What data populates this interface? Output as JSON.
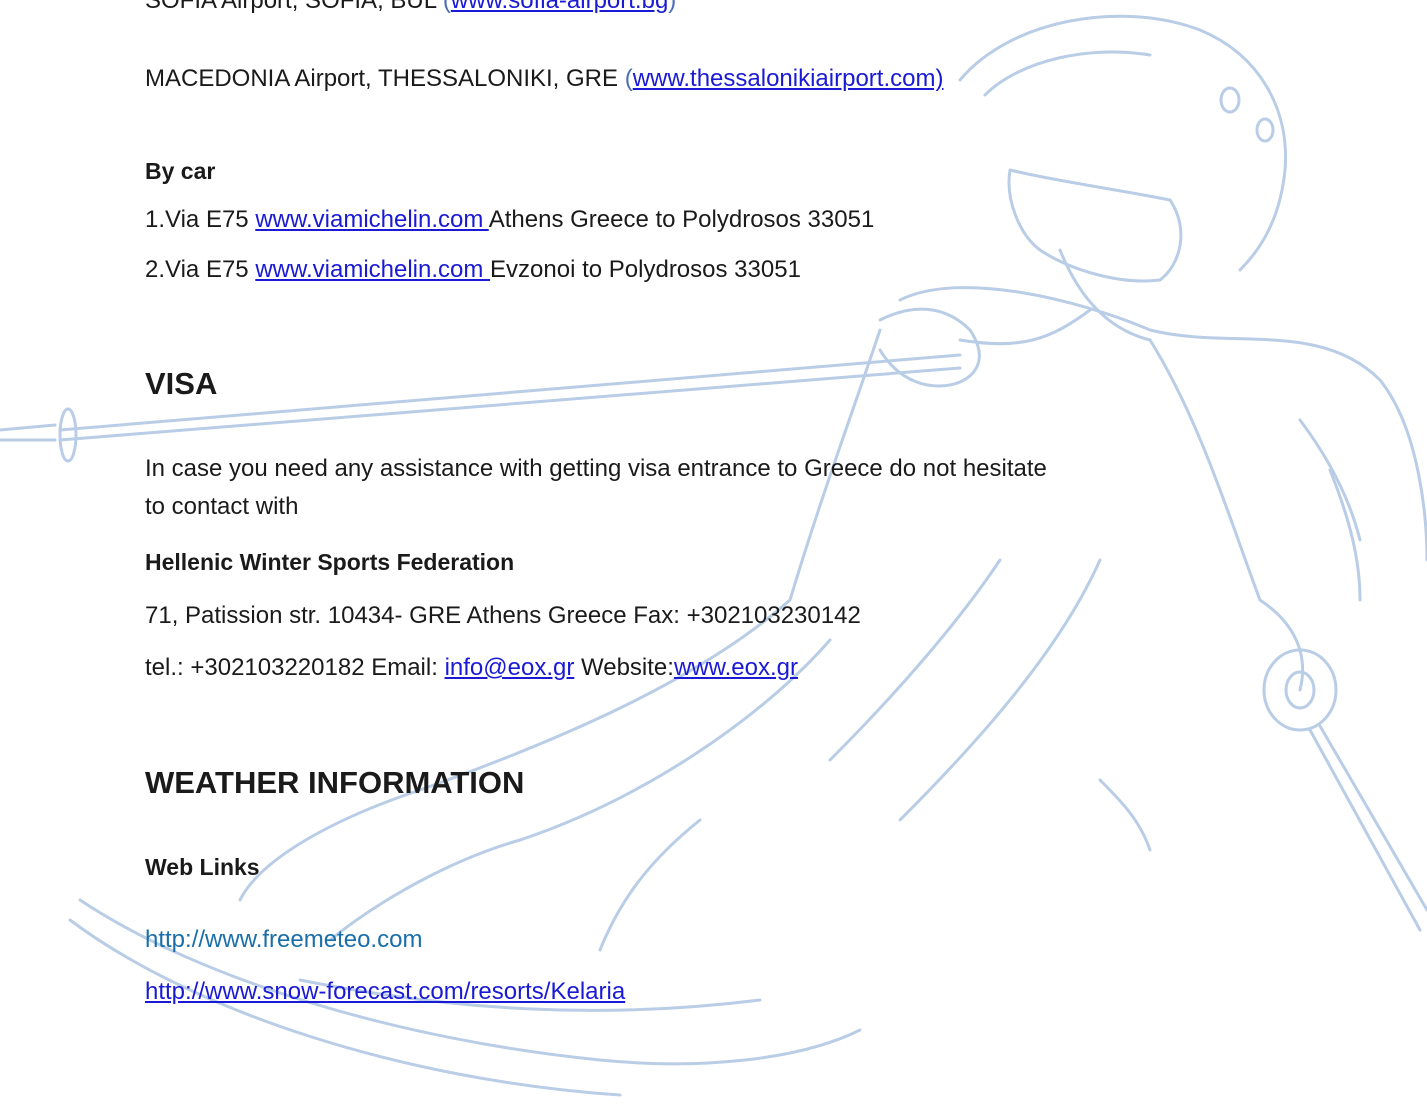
{
  "airport_cut": {
    "text": "SOFIA Airport, SOFIA, BUL",
    "link": "www.sofia-airport.bg"
  },
  "airport_thess": {
    "text": "MACEDONIA Airport, THESSALONIKI, GRE",
    "paren": "(",
    "link": "www.thessalonikiairport.com)"
  },
  "by_car": {
    "heading": "By car",
    "routes": [
      {
        "prefix": "1.Via E75",
        "link": "www.viamichelin.com ",
        "suffix": " Athens Greece to Polydrosos 33051"
      },
      {
        "prefix": "2.Via E75",
        "link": "www.viamichelin.com ",
        "suffix": "Evzonoi to Polydrosos 33051"
      }
    ]
  },
  "visa": {
    "heading": "VISA",
    "text_line1": "In case you need any assistance with getting visa entrance to Greece do not hesitate",
    "text_line2": "to contact with",
    "org_name": "Hellenic Winter Sports Federation",
    "address": "71, Patission str. 10434- GRE Athens Greece Fax: +302103230142",
    "tel_prefix": "tel.: +302103220182 Email: ",
    "email": "info@eox.gr",
    "website_label": " Website:",
    "website": "www.eox.gr"
  },
  "weather": {
    "heading": "WEATHER INFORMATION",
    "subheading": "Web Links",
    "link1": "http://www.freemeteo.com",
    "link2": "http://www.snow-forecast.com/resorts/Kelaria"
  },
  "colors": {
    "link": "#1a1ad6",
    "watermark": "#b9cde6"
  },
  "watermark_icon": "skier-illustration"
}
